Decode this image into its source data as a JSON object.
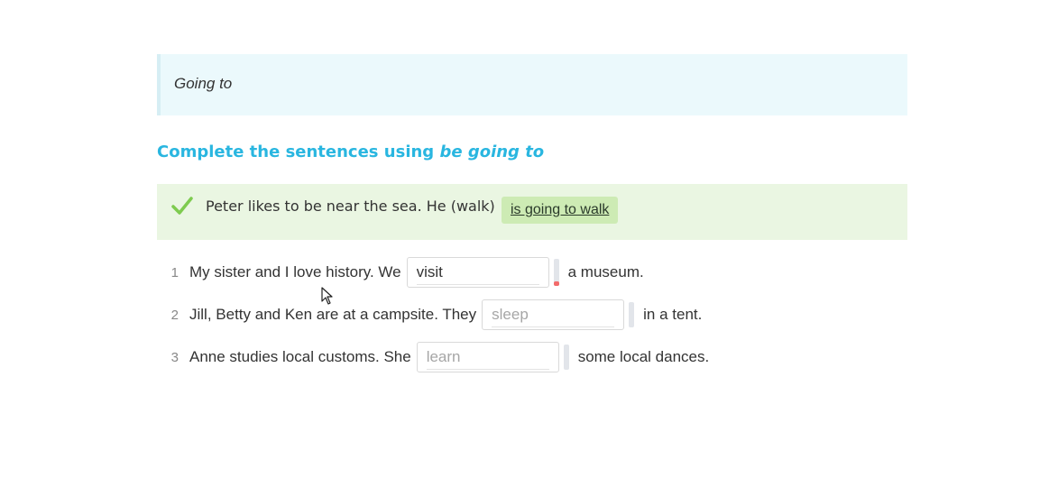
{
  "topic": {
    "title": "Going to"
  },
  "instruction": {
    "prefix": "Complete the sentences using ",
    "emphasis": "be going to"
  },
  "example": {
    "icon": "checkmark-icon",
    "check_color": "#7ecb4f",
    "text": "Peter likes to be near the sea. He (walk)",
    "answer": "is going to walk"
  },
  "questions": [
    {
      "number": "1",
      "before": "My sister and I love history. We",
      "value": "visit",
      "placeholder": "",
      "after": "a museum.",
      "status": "incorrect"
    },
    {
      "number": "2",
      "before": "Jill, Betty and Ken are at a campsite. They",
      "value": "",
      "placeholder": "sleep",
      "after": "in a tent.",
      "status": "unanswered"
    },
    {
      "number": "3",
      "before": "Anne studies local customs. She",
      "value": "",
      "placeholder": "learn",
      "after": "some local dances.",
      "status": "unanswered"
    }
  ],
  "colors": {
    "accent": "#29b6e0",
    "topic_bg": "#ebf9fc",
    "example_bg": "#eaf6e2",
    "answer_bg": "#cdebb4",
    "error": "#f36b6b"
  }
}
